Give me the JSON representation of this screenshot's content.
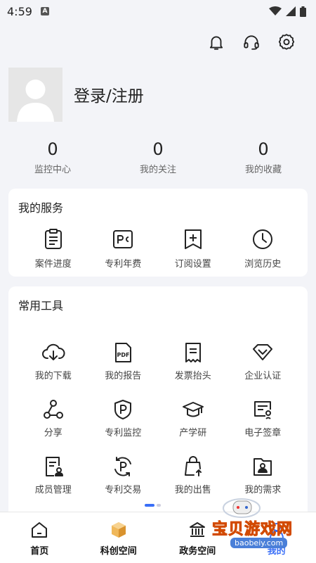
{
  "status_bar": {
    "time": "4:59",
    "notification_badge": "A"
  },
  "header": {
    "icons": [
      "bell-icon",
      "headset-icon",
      "gear-icon"
    ]
  },
  "profile": {
    "login_text": "登录/注册"
  },
  "stats": [
    {
      "value": "0",
      "label": "监控中心"
    },
    {
      "value": "0",
      "label": "我的关注"
    },
    {
      "value": "0",
      "label": "我的收藏"
    }
  ],
  "services": {
    "title": "我的服务",
    "items": [
      {
        "label": "案件进度",
        "icon": "clipboard-icon"
      },
      {
        "label": "专利年费",
        "icon": "pc-badge-icon"
      },
      {
        "label": "订阅设置",
        "icon": "subscribe-icon"
      },
      {
        "label": "浏览历史",
        "icon": "clock-icon"
      }
    ]
  },
  "tools": {
    "title": "常用工具",
    "items": [
      {
        "label": "我的下载",
        "icon": "cloud-download-icon"
      },
      {
        "label": "我的报告",
        "icon": "pdf-icon"
      },
      {
        "label": "发票抬头",
        "icon": "invoice-icon"
      },
      {
        "label": "企业认证",
        "icon": "diamond-check-icon"
      },
      {
        "label": "分享",
        "icon": "share-icon"
      },
      {
        "label": "专利监控",
        "icon": "shield-p-icon"
      },
      {
        "label": "产学研",
        "icon": "graduation-cap-icon"
      },
      {
        "label": "电子签章",
        "icon": "certificate-icon"
      },
      {
        "label": "成员管理",
        "icon": "member-doc-icon"
      },
      {
        "label": "专利交易",
        "icon": "cycle-p-icon"
      },
      {
        "label": "我的出售",
        "icon": "shopping-bag-icon"
      },
      {
        "label": "我的需求",
        "icon": "folder-user-icon"
      }
    ]
  },
  "tabbar": [
    {
      "label": "首页",
      "icon": "home-icon"
    },
    {
      "label": "科创空间",
      "icon": "cube-icon"
    },
    {
      "label": "政务空间",
      "icon": "government-icon"
    },
    {
      "label": "我的",
      "icon": "user-icon"
    }
  ],
  "watermark": {
    "title": "宝贝游戏网",
    "url": "baobeiy.com"
  },
  "colors": {
    "accent": "#3a6ff7",
    "background": "#f3f4f8",
    "card": "#ffffff"
  }
}
